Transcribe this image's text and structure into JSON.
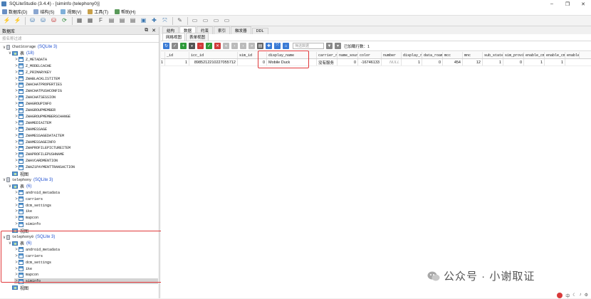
{
  "window": {
    "title": "SQLiteStudio (3.4.4) - [siminfo (telephony0)]"
  },
  "menu": [
    "数据库(D)",
    "结构(S)",
    "视图(V)",
    "工具(T)",
    "帮助(H)"
  ],
  "dock": {
    "title": "数据库",
    "filter_placeholder": "按名称过滤"
  },
  "databases": [
    {
      "name": "ChatStorage",
      "driver": "(SQLite 3)",
      "tables_label": "表",
      "tables_count": "(18)",
      "tables": [
        "Z_METADATA",
        "Z_MODELCACHE",
        "Z_PRIMARYKEY",
        "ZWABLACKLISTITEM",
        "ZWACHATPROPERTIES",
        "ZWACHATPUSHCONFIG",
        "ZWACHATSESSION",
        "ZWAGROUPINFO",
        "ZWAGROUPMEMBER",
        "ZWAGROUPMEMBERSCHANGE",
        "ZWAMEDIAITEM",
        "ZWAMESSAGE",
        "ZWAMESSAGEDATAITEM",
        "ZWAMESSAGEINFO",
        "ZWAPROFILEPICTUREITEM",
        "ZWAPROFILEPUSHNAME",
        "ZWAVCARDMENTION",
        "ZWAZ1PAYMENTTRANSACTION"
      ],
      "views_label": "视图"
    },
    {
      "name": "telephony",
      "driver": "(SQLite 3)",
      "tables_label": "表",
      "tables_count": "(6)",
      "tables": [
        "android_metadata",
        "carriers",
        "dcm_settings",
        "ike",
        "mapcon",
        "siminfo"
      ],
      "views_label": "视图"
    },
    {
      "name": "telephony0",
      "driver": "(SQLite 3)",
      "tables_label": "表",
      "tables_count": "(6)",
      "tables": [
        "android_metadata",
        "carriers",
        "dcm_settings",
        "ike",
        "mapcon",
        "siminfo"
      ],
      "views_label": "视图"
    }
  ],
  "editor": {
    "tabs": [
      "结构",
      "数据",
      "约束",
      "索引",
      "触发器",
      "DDL"
    ],
    "subtabs": [
      "网格视图",
      "表单视图"
    ],
    "filter_placeholder": "筛选数据",
    "loaded_rows": "已加载行数：1"
  },
  "grid": {
    "columns": [
      "_id",
      "icc_id",
      "sim_id",
      "display_name",
      "carrier_r",
      "name_sour",
      "color",
      "number",
      "display_r",
      "data_roam",
      "mcc",
      "mnc",
      "sub_state",
      "sim_provi",
      "enable_cm",
      "enable_cm",
      "enable_cm"
    ],
    "rows": [
      [
        "1",
        "1",
        "8985212210227055712",
        "0",
        "Mobile Duck",
        "没有服务",
        "0",
        "-16746133",
        "NULL",
        "1",
        "0",
        "454",
        "12",
        "1",
        "0",
        "1",
        "1"
      ]
    ]
  },
  "watermark": "公众号 · 小谢取证",
  "colors": {
    "highlight": "#e0383a",
    "link": "#1f4fd0",
    "null": "#9a9a9a"
  }
}
